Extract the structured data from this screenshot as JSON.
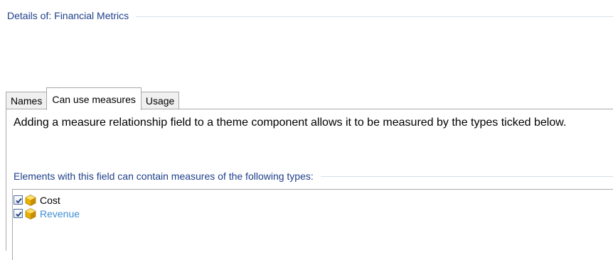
{
  "header": {
    "title": "Details of: Financial Metrics"
  },
  "tabs": [
    {
      "label": "Names",
      "active": false
    },
    {
      "label": "Can use measures",
      "active": true
    },
    {
      "label": "Usage",
      "active": false
    }
  ],
  "panel": {
    "description": "Adding a measure relationship field to a theme component allows it to be measured by the types ticked below.",
    "group_title": "Elements with this field can contain measures of the following types:"
  },
  "measures": [
    {
      "label": "Cost",
      "checked": true,
      "icon": "gold-cube-icon"
    },
    {
      "label": "Revenue",
      "checked": true,
      "icon": "gold-cube-icon"
    }
  ],
  "colors": {
    "accent": "#1e3f8a",
    "link": "#3d8fd4",
    "divider": "#d6dfee",
    "cube": "#e8b000"
  }
}
